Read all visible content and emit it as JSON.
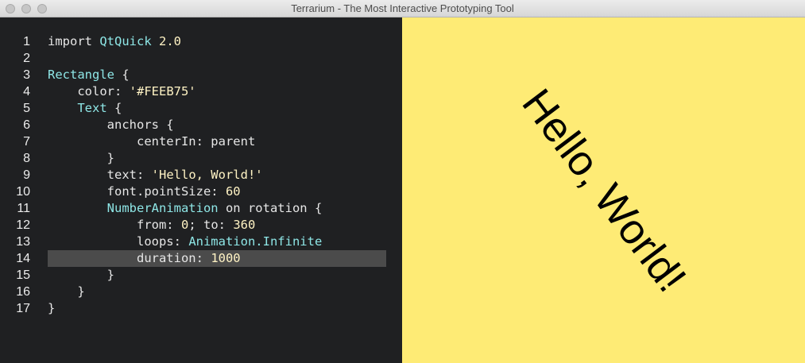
{
  "window": {
    "title": "Terrarium - The Most Interactive Prototyping Tool"
  },
  "editor": {
    "line_numbers": [
      "1",
      "2",
      "3",
      "4",
      "5",
      "6",
      "7",
      "8",
      "9",
      "10",
      "11",
      "12",
      "13",
      "14",
      "15",
      "16",
      "17"
    ],
    "current_line": 14,
    "lines": [
      [
        {
          "t": "import ",
          "k": "plain"
        },
        {
          "t": "QtQuick",
          "k": "type"
        },
        {
          "t": " ",
          "k": "plain"
        },
        {
          "t": "2.0",
          "k": "num"
        }
      ],
      [],
      [
        {
          "t": "Rectangle",
          "k": "type"
        },
        {
          "t": " {",
          "k": "plain"
        }
      ],
      [
        {
          "t": "    color: ",
          "k": "plain"
        },
        {
          "t": "'#FEEB75'",
          "k": "str"
        }
      ],
      [
        {
          "t": "    ",
          "k": "plain"
        },
        {
          "t": "Text",
          "k": "type"
        },
        {
          "t": " {",
          "k": "plain"
        }
      ],
      [
        {
          "t": "        anchors {",
          "k": "plain"
        }
      ],
      [
        {
          "t": "            centerIn: parent",
          "k": "plain"
        }
      ],
      [
        {
          "t": "        }",
          "k": "plain"
        }
      ],
      [
        {
          "t": "        text: ",
          "k": "plain"
        },
        {
          "t": "'Hello, World!'",
          "k": "str"
        }
      ],
      [
        {
          "t": "        font.pointSize: ",
          "k": "plain"
        },
        {
          "t": "60",
          "k": "num"
        }
      ],
      [
        {
          "t": "        ",
          "k": "plain"
        },
        {
          "t": "NumberAnimation",
          "k": "type"
        },
        {
          "t": " on rotation {",
          "k": "plain"
        }
      ],
      [
        {
          "t": "            from: ",
          "k": "plain"
        },
        {
          "t": "0",
          "k": "num"
        },
        {
          "t": "; to: ",
          "k": "plain"
        },
        {
          "t": "360",
          "k": "num"
        }
      ],
      [
        {
          "t": "            loops: ",
          "k": "plain"
        },
        {
          "t": "Animation.Infinite",
          "k": "type"
        }
      ],
      [
        {
          "t": "            duration: ",
          "k": "plain"
        },
        {
          "t": "1000",
          "k": "num"
        }
      ],
      [
        {
          "t": "        }",
          "k": "plain"
        }
      ],
      [
        {
          "t": "    }",
          "k": "plain"
        }
      ],
      [
        {
          "t": "}",
          "k": "plain"
        }
      ]
    ]
  },
  "preview": {
    "background": "#FEEB75",
    "text": "Hello, World!",
    "rotation_degrees": 53
  },
  "colors": {
    "editor_bg": "#1f2022",
    "current_line": "#4b4b4b",
    "type_token": "#8ee6e6",
    "string_token": "#fff3c4"
  }
}
